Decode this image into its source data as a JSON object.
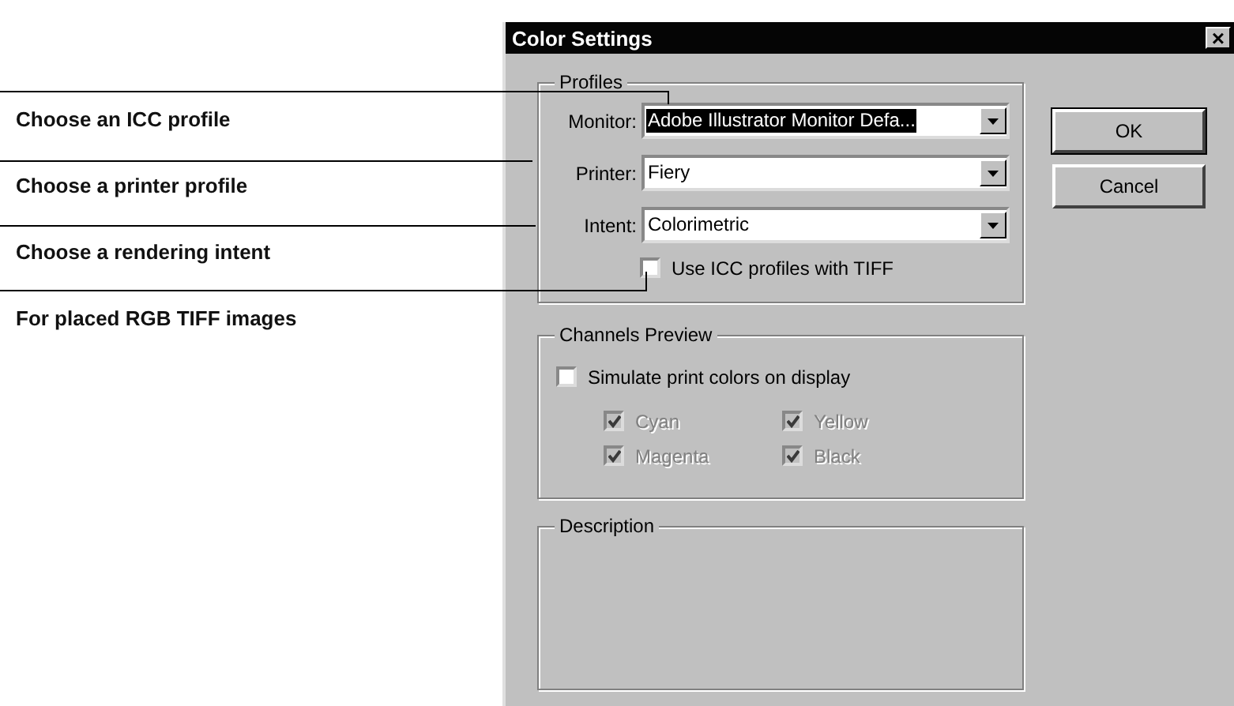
{
  "callouts": [
    {
      "text": "Choose an ICC profile"
    },
    {
      "text": "Choose a printer profile"
    },
    {
      "text": "Choose a rendering intent"
    },
    {
      "text": "For placed RGB TIFF images"
    }
  ],
  "window": {
    "title": "Color Settings",
    "close": "×"
  },
  "profiles": {
    "title": "Profiles",
    "fields": [
      {
        "label": "Monitor:",
        "value": "Adobe Illustrator Monitor Defa...",
        "highlighted": true
      },
      {
        "label": "Printer:",
        "value": "Fiery",
        "highlighted": false
      },
      {
        "label": "Intent:",
        "value": "Colorimetric",
        "highlighted": false
      }
    ],
    "checkbox": {
      "label": "Use ICC profiles with TIFF",
      "checked": false,
      "disabled": false
    }
  },
  "channels_preview": {
    "title": "Channels Preview",
    "simulate": {
      "label": "Simulate print colors on display",
      "checked": false,
      "disabled": false
    },
    "channels": [
      {
        "label": "Cyan",
        "checked": true,
        "disabled": true
      },
      {
        "label": "Yellow",
        "checked": true,
        "disabled": true
      },
      {
        "label": "Magenta",
        "checked": true,
        "disabled": true
      },
      {
        "label": "Black",
        "checked": true,
        "disabled": true
      }
    ]
  },
  "description": {
    "title": "Description"
  },
  "buttons": [
    {
      "label": "OK",
      "default": true
    },
    {
      "label": "Cancel",
      "default": false
    }
  ]
}
